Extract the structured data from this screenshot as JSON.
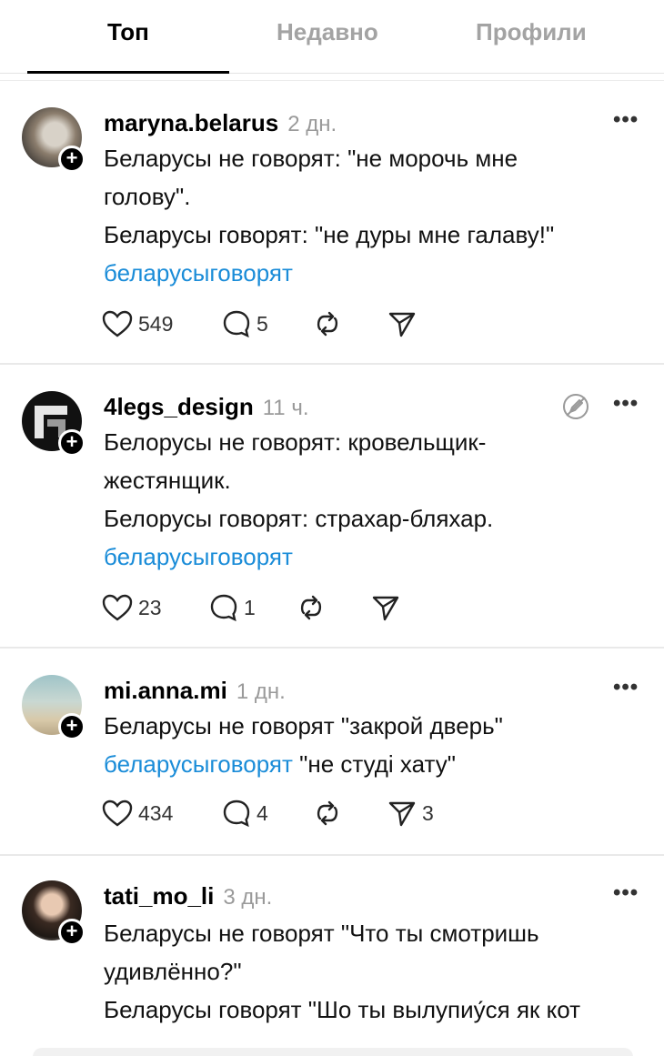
{
  "tabs": {
    "top": "Топ",
    "recent": "Недавно",
    "profiles": "Профили"
  },
  "posts": [
    {
      "username": "maryna.belarus",
      "time": "2 дн.",
      "lines": [
        "Беларусы не говорят: \"не морочь  мне",
        "голову\".",
        "Беларусы говорят: \"не дуры мне галаву!\""
      ],
      "tag": "беларусыговорят",
      "likes": "549",
      "comments": "5",
      "shares": ""
    },
    {
      "username": "4legs_design",
      "time": "11 ч.",
      "lines": [
        "Белорусы не говорят: кровельщик-",
        "жестянщик.",
        "Белорусы говорят: страхар-бляхар."
      ],
      "tag": "беларусыговорят",
      "likes": "23",
      "comments": "1",
      "shares": ""
    },
    {
      "username": "mi.anna.mi",
      "time": "1 дн.",
      "lines": [
        "Беларусы не говорят \"закрой дверь\""
      ],
      "tag": "беларусыговорят",
      "tag_suffix": " \"не студі хату\"",
      "likes": "434",
      "comments": "4",
      "shares": "3"
    },
    {
      "username": "tati_mo_li",
      "time": "3 дн.",
      "lines": [
        "Беларусы не говорят \"Что ты смотришь",
        "удивлённо?\"",
        "Беларусы говорят \"Шо ты вылупиу́ся як кот"
      ]
    }
  ],
  "icons": {
    "like": "heart-icon",
    "comment": "comment-icon",
    "repost": "repost-icon",
    "share": "send-icon",
    "more": "more-icon",
    "follow": "plus-icon",
    "edit": "edit-off-icon"
  },
  "colors": {
    "hashtag": "#1a8cd8",
    "muted": "#9a9a9a"
  }
}
